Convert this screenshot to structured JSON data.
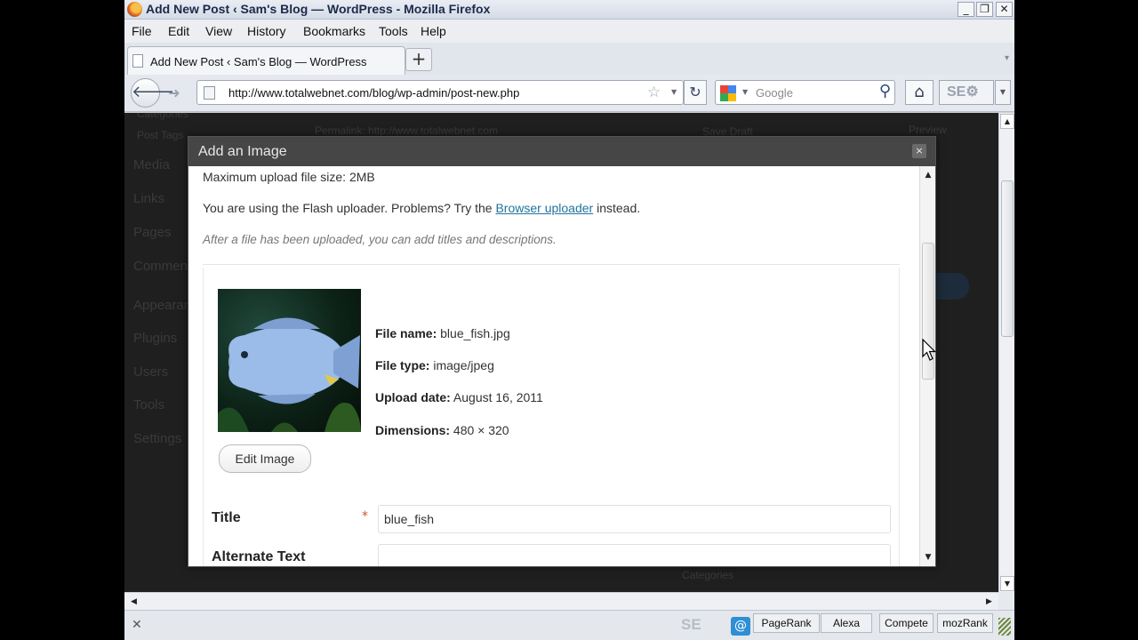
{
  "window": {
    "title": "Add New Post ‹ Sam's Blog — WordPress - Mozilla Firefox",
    "min": "_",
    "max": "❐",
    "close": "✕"
  },
  "menu": [
    "File",
    "Edit",
    "View",
    "History",
    "Bookmarks",
    "Tools",
    "Help"
  ],
  "tab": {
    "label": "Add New Post ‹ Sam's Blog — WordPress",
    "new_tab": "+"
  },
  "nav": {
    "url": "http://www.totalwebnet.com/blog/wp-admin/post-new.php",
    "search_placeholder": "Google",
    "seo_label": "SE"
  },
  "background_page": {
    "sidebar": [
      "Categories",
      "Post Tags",
      "Media",
      "Links",
      "Pages",
      "Comments",
      "Appearance",
      "Plugins",
      "Users",
      "Tools",
      "Settings"
    ],
    "permalink": "Permalink: http://www.totalwebnet.com",
    "save_draft": "Save Draft",
    "preview": "Preview",
    "categories": "Categories"
  },
  "dialog": {
    "title": "Add an Image",
    "close": "×",
    "max_upload": "Maximum upload file size: 2MB",
    "flash_text_before": "You are using the Flash uploader. Problems? Try the ",
    "flash_link": "Browser uploader",
    "flash_text_after": " instead.",
    "note": "After a file has been uploaded, you can add titles and descriptions.",
    "file": {
      "name_label": "File name:",
      "name": "blue_fish.jpg",
      "type_label": "File type:",
      "type": "image/jpeg",
      "date_label": "Upload date:",
      "date": "August 16, 2011",
      "dim_label": "Dimensions:",
      "dimensions": "480 × 320"
    },
    "edit_image_button": "Edit Image",
    "fields": {
      "title_label": "Title",
      "required_mark": "*",
      "title_value": "blue_fish",
      "alt_label": "Alternate Text",
      "alt_value": ""
    }
  },
  "statusbar": {
    "close": "✕",
    "seo": "SE",
    "buttons": [
      "PageRank",
      "Alexa",
      "Compete",
      "mozRank"
    ]
  }
}
